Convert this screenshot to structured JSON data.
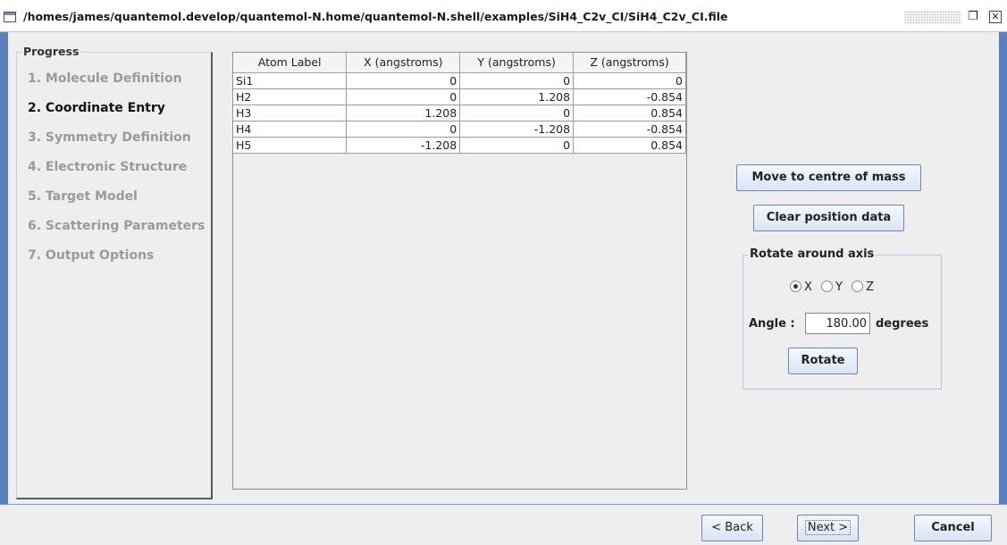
{
  "window": {
    "title": "/homes/james/quantemol.develop/quantemol-N.home/quantemol-N.shell/examples/SiH4_C2v_CI/SiH4_C2v_CI.file",
    "restore_glyph": "❐",
    "close_glyph": "✕"
  },
  "progress": {
    "title": "Progress",
    "steps": [
      {
        "label": "1. Molecule Definition",
        "active": false
      },
      {
        "label": "2. Coordinate Entry",
        "active": true
      },
      {
        "label": "3. Symmetry Definition",
        "active": false
      },
      {
        "label": "4. Electronic Structure",
        "active": false
      },
      {
        "label": "5. Target Model",
        "active": false
      },
      {
        "label": "6. Scattering Parameters",
        "active": false
      },
      {
        "label": "7. Output Options",
        "active": false
      }
    ]
  },
  "table": {
    "headers": [
      "Atom Label",
      "X (angstroms)",
      "Y (angstroms)",
      "Z (angstroms)"
    ],
    "rows": [
      [
        "Si1",
        "0",
        "0",
        "0"
      ],
      [
        "H2",
        "0",
        "1.208",
        "-0.854"
      ],
      [
        "H3",
        "1.208",
        "0",
        "0.854"
      ],
      [
        "H4",
        "0",
        "-1.208",
        "-0.854"
      ],
      [
        "H5",
        "-1.208",
        "0",
        "0.854"
      ]
    ]
  },
  "controls": {
    "move_label": "Move to centre of mass",
    "clear_label": "Clear position data",
    "rotate_group_label": "Rotate around axis",
    "axes": [
      {
        "label": "X",
        "selected": true
      },
      {
        "label": "Y",
        "selected": false
      },
      {
        "label": "Z",
        "selected": false
      }
    ],
    "angle_label": "Angle :",
    "angle_value": "180.00",
    "degrees_label": "degrees",
    "rotate_label": "Rotate"
  },
  "nav": {
    "back_label": "< Back",
    "next_label": "Next >",
    "cancel_label": "Cancel"
  },
  "colors": {
    "frame_blue": "#5b7fbd",
    "button_border": "#6d86b8",
    "inactive_step": "#9a9a9a"
  }
}
